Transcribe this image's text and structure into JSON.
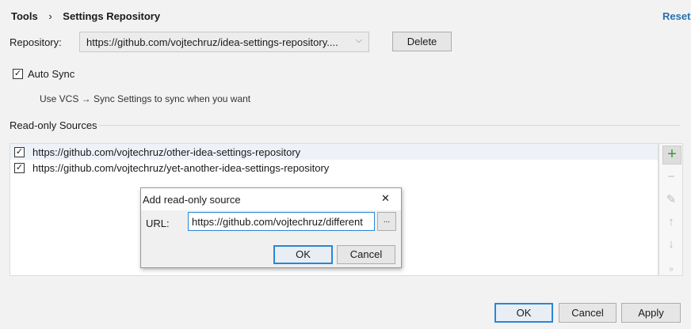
{
  "breadcrumb": {
    "parent": "Tools",
    "separator": "›",
    "current": "Settings Repository"
  },
  "reset_label": "Reset",
  "repository": {
    "label": "Repository:",
    "value": "https://github.com/vojtechruz/idea-settings-repository....",
    "delete_label": "Delete"
  },
  "auto_sync": {
    "label": "Auto Sync",
    "checked": true,
    "hint": "Use VCS → Sync Settings to sync when you want"
  },
  "readonly": {
    "title": "Read-only Sources",
    "items": [
      {
        "url": "https://github.com/vojtechruz/other-idea-settings-repository",
        "checked": true
      },
      {
        "url": "https://github.com/vojtechruz/yet-another-idea-settings-repository",
        "checked": true
      }
    ]
  },
  "toolbar": {
    "add": "+",
    "remove": "−",
    "edit": "✎",
    "up": "↑",
    "down": "↓",
    "more": "»"
  },
  "dialog": {
    "title": "Add read-only source",
    "close": "✕",
    "url_label": "URL:",
    "url_value": "https://github.com/vojtechruz/different",
    "browse": "...",
    "ok": "OK",
    "cancel": "Cancel"
  },
  "footer": {
    "ok": "OK",
    "cancel": "Cancel",
    "apply": "Apply"
  },
  "colors": {
    "accent": "#2a86d6",
    "link": "#2470b3",
    "add": "#3a9a3a"
  }
}
